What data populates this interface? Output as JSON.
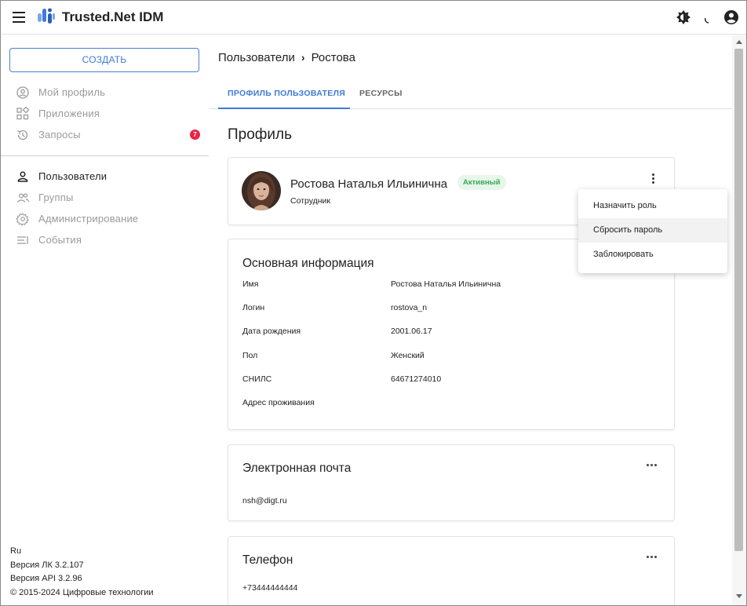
{
  "header": {
    "title": "Trusted.Net IDM"
  },
  "sidebar": {
    "create_label": "СОЗДАТЬ",
    "items": [
      {
        "label": "Мой профиль",
        "icon": "user-circle-icon"
      },
      {
        "label": "Приложения",
        "icon": "apps-grid-icon"
      },
      {
        "label": "Запросы",
        "icon": "history-icon",
        "badge": "7"
      },
      {
        "label": "Пользователи",
        "icon": "user-icon",
        "active": true
      },
      {
        "label": "Группы",
        "icon": "group-icon"
      },
      {
        "label": "Администрирование",
        "icon": "gear-icon"
      },
      {
        "label": "События",
        "icon": "events-list-icon"
      }
    ],
    "footer": {
      "lang": "Ru",
      "lk_version": "Версия ЛК 3.2.107",
      "api_version": "Версия API 3.2.96",
      "copyright": "© 2015-2024 Цифровые технологии"
    }
  },
  "main": {
    "breadcrumb": {
      "root": "Пользователи",
      "current": "Ростова"
    },
    "tabs": [
      {
        "label": "ПРОФИЛЬ ПОЛЬЗОВАТЕЛЯ",
        "active": true
      },
      {
        "label": "РЕСУРСЫ",
        "active": false
      }
    ],
    "section_title": "Профиль",
    "user": {
      "name": "Ростова Наталья Ильинична",
      "status": "Активный",
      "role": "Сотрудник"
    },
    "basic_info": {
      "title": "Основная информация",
      "fields": [
        {
          "label": "Имя",
          "value": "Ростова Наталья Ильинична"
        },
        {
          "label": "Логин",
          "value": "rostova_n"
        },
        {
          "label": "Дата рождения",
          "value": "2001.06.17"
        },
        {
          "label": "Пол",
          "value": "Женский"
        },
        {
          "label": "СНИЛС",
          "value": "64671274010"
        },
        {
          "label": "Адрес проживания",
          "value": ""
        }
      ]
    },
    "email": {
      "title": "Электронная почта",
      "value": "nsh@digt.ru"
    },
    "phone": {
      "title": "Телефон",
      "value": "+73444444444"
    }
  },
  "menu": {
    "items": [
      "Назначить роль",
      "Сбросить пароль",
      "Заблокировать"
    ],
    "hovered_index": 1
  },
  "colors": {
    "accent": "#3f7ad6",
    "badge": "#e62745",
    "status_bg": "#e6f6e9",
    "status_text": "#3aa657"
  }
}
